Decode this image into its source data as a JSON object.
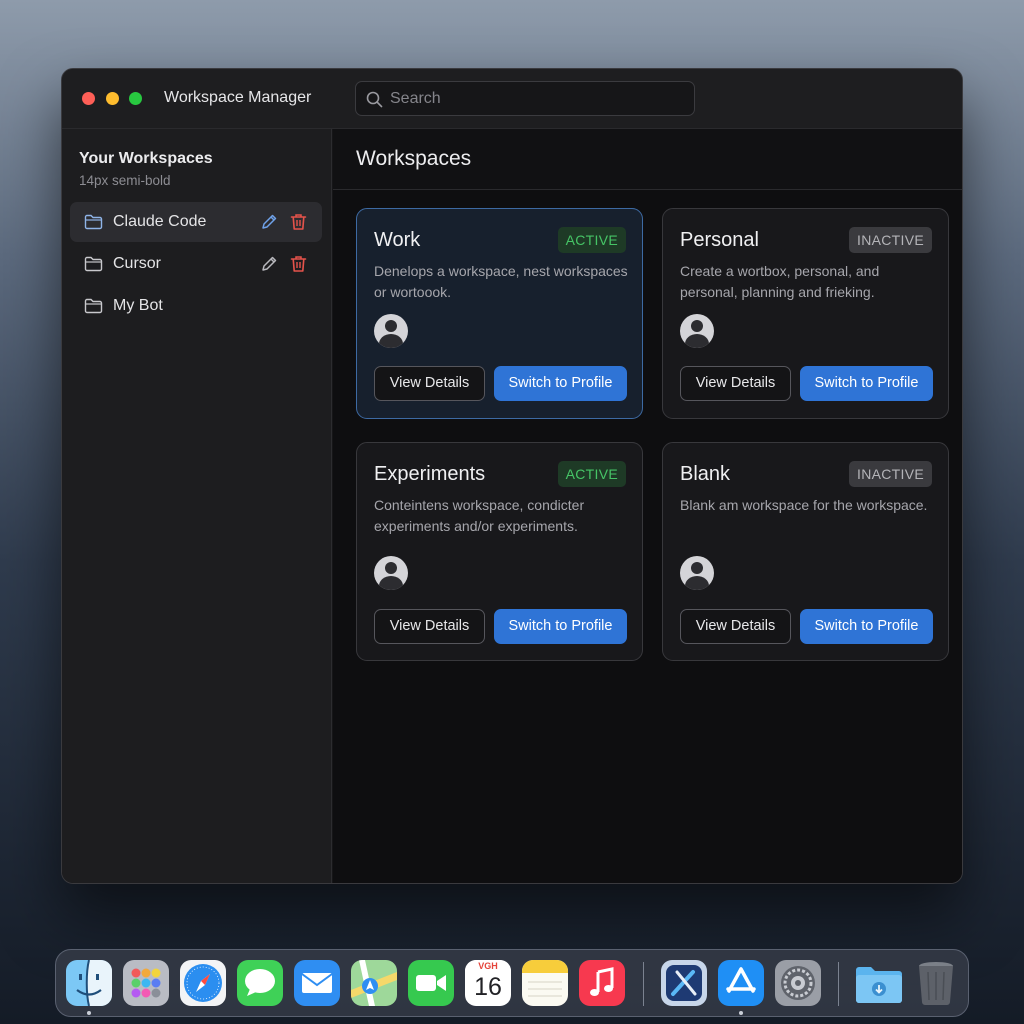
{
  "window": {
    "title": "Workspace Manager",
    "search_placeholder": "Search"
  },
  "sidebar": {
    "heading": "Your Workspaces",
    "subheading": "14px semi-bold",
    "items": [
      {
        "label": "Claude Code",
        "selected": true,
        "icons": [
          "folder-icon",
          "edit-icon",
          "trash-icon"
        ]
      },
      {
        "label": "Cursor",
        "selected": false,
        "icons": [
          "folder-icon",
          "edit-icon",
          "trash-icon"
        ]
      },
      {
        "label": "My Bot",
        "selected": false,
        "icons": [
          "folder-icon"
        ]
      }
    ]
  },
  "main": {
    "title": "Workspaces",
    "cards": [
      {
        "name": "Work",
        "status": "ACTIVE",
        "description": "Denelops a workspace, nest workspaces or wortoook.",
        "view_label": "View Details",
        "switch_label": "Switch to Profile"
      },
      {
        "name": "Personal",
        "status": "INACTIVE",
        "description": "Create a wortbox, personal, and personal, planning and frieking.",
        "view_label": "View Details",
        "switch_label": "Switch to Profile"
      },
      {
        "name": "Experiments",
        "status": "ACTIVE",
        "description": "Conteintens workspace, condicter experiments and/or experiments.",
        "view_label": "View Details",
        "switch_label": "Switch to Profile"
      },
      {
        "name": "Blank",
        "status": "INACTIVE",
        "description": "Blank am workspace for the workspace.",
        "view_label": "View Details",
        "switch_label": "Switch to Profile"
      }
    ]
  },
  "dock": {
    "calendar_month": "VGH",
    "calendar_day": "16",
    "apps": [
      "finder-icon",
      "launchpad-icon",
      "safari-icon",
      "messages-icon",
      "mail-icon",
      "maps-icon",
      "facetime-icon",
      "calendar-icon",
      "notes-icon",
      "music-icon",
      "xcode-icon",
      "app-store-icon",
      "system-settings-icon",
      "downloads-folder-icon",
      "trash-icon"
    ]
  },
  "colors": {
    "accent": "#2f74d6",
    "active_badge": "#46c466",
    "inactive_badge": "#b4b4b8",
    "danger": "#e5534b"
  }
}
